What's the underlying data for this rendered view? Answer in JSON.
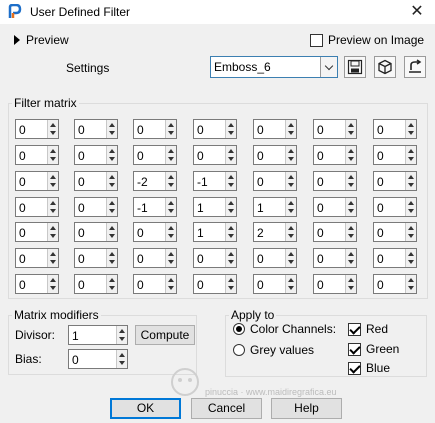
{
  "window": {
    "title": "User Defined Filter",
    "close": "✕"
  },
  "preview": {
    "label": "Preview",
    "on_image_label": "Preview on Image",
    "on_image_checked": false
  },
  "settings": {
    "label": "Settings",
    "preset": "Emboss_6"
  },
  "matrix": {
    "title": "Filter matrix",
    "rows": [
      [
        "0",
        "0",
        "0",
        "0",
        "0",
        "0",
        "0"
      ],
      [
        "0",
        "0",
        "0",
        "0",
        "0",
        "0",
        "0"
      ],
      [
        "0",
        "0",
        "-2",
        "-1",
        "0",
        "0",
        "0"
      ],
      [
        "0",
        "0",
        "-1",
        "1",
        "1",
        "0",
        "0"
      ],
      [
        "0",
        "0",
        "0",
        "1",
        "2",
        "0",
        "0"
      ],
      [
        "0",
        "0",
        "0",
        "0",
        "0",
        "0",
        "0"
      ],
      [
        "0",
        "0",
        "0",
        "0",
        "0",
        "0",
        "0"
      ]
    ]
  },
  "modifiers": {
    "title": "Matrix modifiers",
    "divisor_label": "Divisor:",
    "divisor": "1",
    "compute_label": "Compute",
    "bias_label": "Bias:",
    "bias": "0"
  },
  "apply_to": {
    "title": "Apply to",
    "color_channels_label": "Color Channels:",
    "grey_values_label": "Grey values",
    "mode": "color",
    "red_label": "Red",
    "green_label": "Green",
    "blue_label": "Blue",
    "red": true,
    "green": true,
    "blue": true
  },
  "buttons": {
    "ok": "OK",
    "cancel": "Cancel",
    "help": "Help"
  },
  "watermark": {
    "text": "pinuccia · www.maidiregrafica.eu"
  }
}
